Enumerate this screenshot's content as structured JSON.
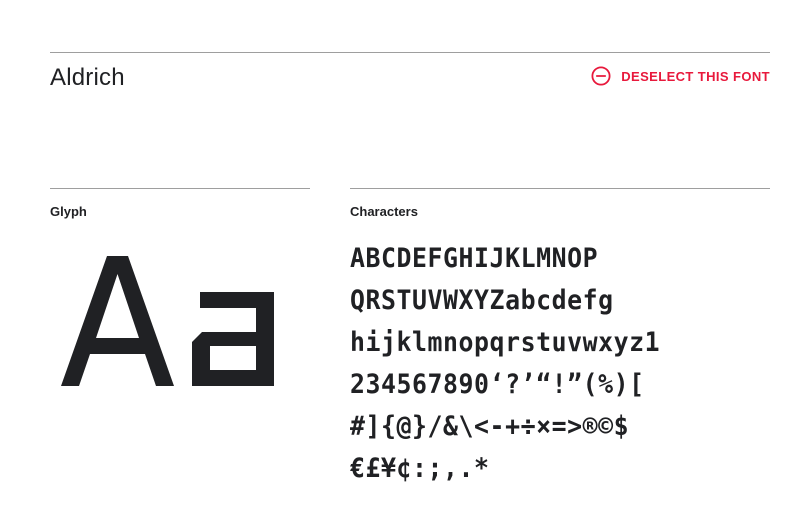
{
  "font": {
    "name": "Aldrich"
  },
  "actions": {
    "deselect_label": "DESELECT THIS FONT",
    "deselect_icon": "minus-circle-icon",
    "accent_color": "#e8193c"
  },
  "glyph": {
    "label": "Glyph",
    "sample": "Aa"
  },
  "characters": {
    "label": "Characters",
    "lines": [
      "ABCDEFGHIJKLMNOP",
      "QRSTUVWXYZabcdefg",
      "hijklmnopqrstuvwxyz1",
      "234567890‘?’“!”(%)[",
      "#]{@}/&\\<-+÷×=>®©$",
      "€£¥¢:;,.*"
    ]
  }
}
